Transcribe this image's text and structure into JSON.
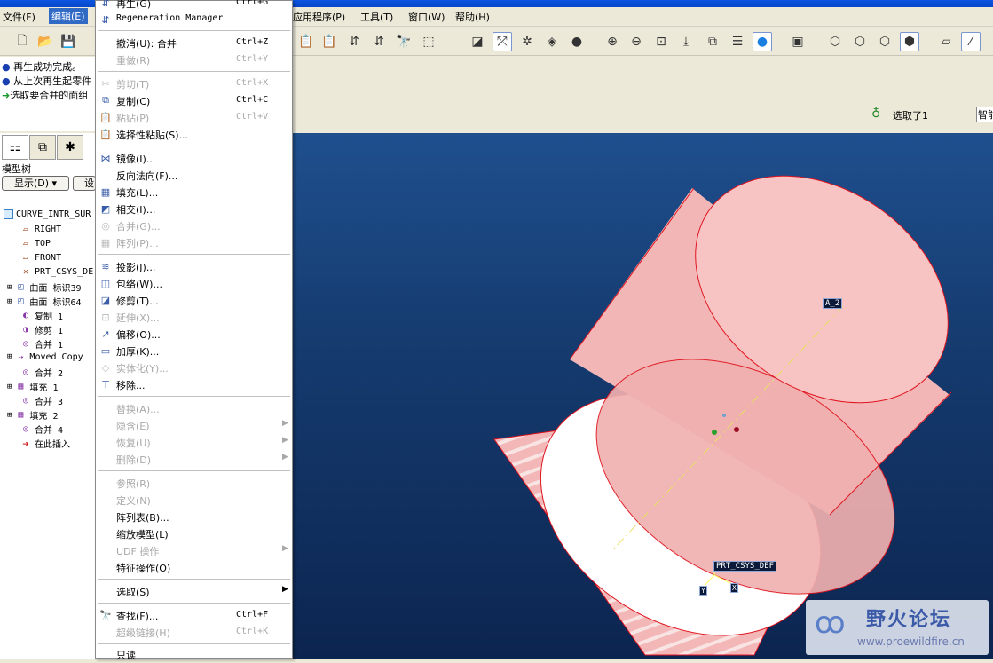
{
  "menubar": {
    "file": "文件(F)",
    "edit": "编辑(E)",
    "apps": "应用程序(P)",
    "tools": "工具(T)",
    "window": "窗口(W)",
    "help": "帮助(H)"
  },
  "messages": [
    "再生成功完成。",
    "从上次再生起零件",
    "选取要合并的面组"
  ],
  "status": {
    "selected": "选取了1",
    "filter": "智能"
  },
  "model_tree": {
    "title": "模型树",
    "show_button": "显示(D)",
    "settings_button": "设",
    "items": [
      {
        "label": "CURVE_INTR_SUR",
        "icon": "part-icon"
      },
      {
        "label": "RIGHT",
        "icon": "datum-plane-icon"
      },
      {
        "label": "TOP",
        "icon": "datum-plane-icon"
      },
      {
        "label": "FRONT",
        "icon": "datum-plane-icon"
      },
      {
        "label": "PRT_CSYS_DE",
        "icon": "csys-icon"
      },
      {
        "label": "曲面 标识39",
        "icon": "surface-icon"
      },
      {
        "label": "曲面 标识64",
        "icon": "surface-icon"
      },
      {
        "label": "复制 1",
        "icon": "copy-icon"
      },
      {
        "label": "修剪 1",
        "icon": "trim-icon"
      },
      {
        "label": "合并 1",
        "icon": "merge-icon"
      },
      {
        "label": "Moved Copy",
        "icon": "moved-copy-icon"
      },
      {
        "label": "合并 2",
        "icon": "merge-icon"
      },
      {
        "label": "填充 1",
        "icon": "fill-icon"
      },
      {
        "label": "合并 3",
        "icon": "merge-icon"
      },
      {
        "label": "填充 2",
        "icon": "fill-icon"
      },
      {
        "label": "合并 4",
        "icon": "merge-icon"
      },
      {
        "label": "在此插入",
        "icon": "insert-here-icon"
      }
    ]
  },
  "edit_menu": {
    "regenerate": {
      "label": "再生(G)",
      "shortcut": "Ctrl+G"
    },
    "regen_manager": {
      "label": "Regeneration Manager"
    },
    "undo": {
      "label": "撤消(U): 合并",
      "shortcut": "Ctrl+Z"
    },
    "redo": {
      "label": "重做(R)",
      "shortcut": "Ctrl+Y"
    },
    "cut": {
      "label": "剪切(T)",
      "shortcut": "Ctrl+X"
    },
    "copy": {
      "label": "复制(C)",
      "shortcut": "Ctrl+C"
    },
    "paste": {
      "label": "粘贴(P)",
      "shortcut": "Ctrl+V"
    },
    "paste_special": {
      "label": "选择性粘贴(S)..."
    },
    "mirror": {
      "label": "镜像(I)..."
    },
    "flip_normal": {
      "label": "反向法向(F)..."
    },
    "fill": {
      "label": "填充(L)..."
    },
    "intersect": {
      "label": "相交(I)..."
    },
    "merge": {
      "label": "合并(G)..."
    },
    "pattern": {
      "label": "阵列(P)..."
    },
    "project": {
      "label": "投影(J)..."
    },
    "wrap": {
      "label": "包络(W)..."
    },
    "trim": {
      "label": "修剪(T)..."
    },
    "extend": {
      "label": "延伸(X)..."
    },
    "offset": {
      "label": "偏移(O)..."
    },
    "thicken": {
      "label": "加厚(K)..."
    },
    "solidify": {
      "label": "实体化(Y)..."
    },
    "remove": {
      "label": "移除..."
    },
    "replace": {
      "label": "替换(A)..."
    },
    "hide": {
      "label": "隐含(E)"
    },
    "resume": {
      "label": "恢复(U)"
    },
    "delete": {
      "label": "删除(D)"
    },
    "references": {
      "label": "参照(R)"
    },
    "definition": {
      "label": "定义(N)"
    },
    "pattern_table": {
      "label": "阵列表(B)..."
    },
    "scale_model": {
      "label": "缩放模型(L)"
    },
    "feature_ops": {
      "label": "特征操作(O)"
    },
    "select": {
      "label": "选取(S)"
    },
    "find": {
      "label": "查找(F)...",
      "shortcut": "Ctrl+F"
    },
    "hyperlink": {
      "label": "超级链接(H)",
      "shortcut": "Ctrl+K"
    },
    "read_only": {
      "label": "只读"
    }
  },
  "viewport": {
    "axis_label": "A_2",
    "csys_label": "PRT_CSYS_DEF",
    "csys_y": "Y",
    "csys_x": "X",
    "colors": {
      "surface": "#f2b6b6",
      "edge": "#e0141e",
      "bg_top": "#1f4f8e",
      "bg_bottom": "#0c2550"
    }
  },
  "watermark": {
    "title": "野火论坛",
    "url": "www.proewildfire.cn"
  }
}
